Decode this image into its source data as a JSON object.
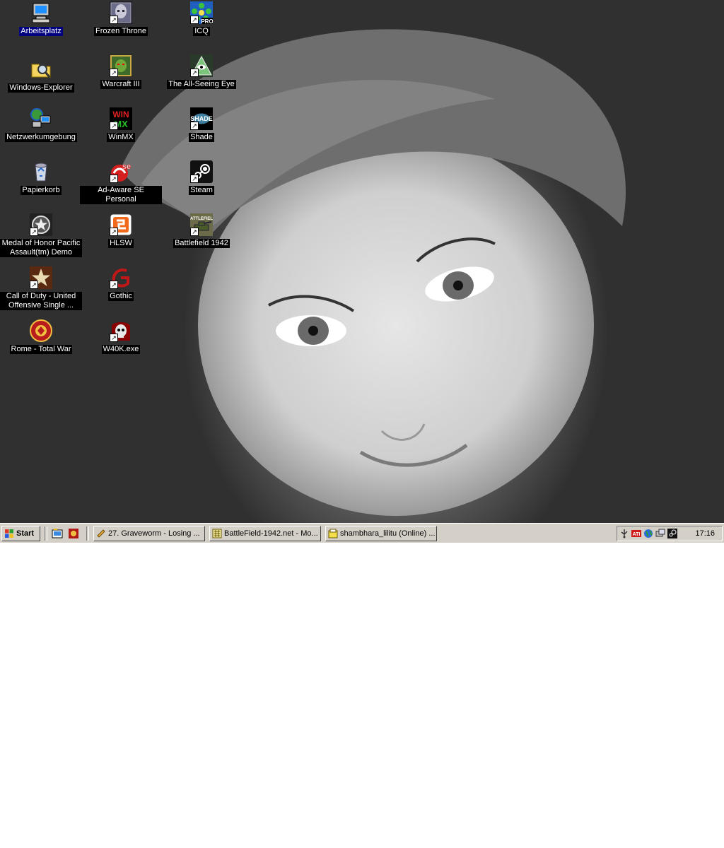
{
  "desktop": {
    "icons": [
      {
        "label": "Arbeitsplatz",
        "icon": "my-computer-icon"
      },
      {
        "label": "Windows-Explorer",
        "icon": "explorer-icon"
      },
      {
        "label": "Netzwerkumgebung",
        "icon": "network-icon"
      },
      {
        "label": "Papierkorb",
        "icon": "recycle-bin-icon"
      },
      {
        "label": "Medal of Honor Pacific Assault(tm) Demo",
        "icon": "medal-of-honor-icon"
      },
      {
        "label": "Call of Duty - United Offensive Single ...",
        "icon": "call-of-duty-icon"
      },
      {
        "label": "Rome - Total War",
        "icon": "rome-total-war-icon"
      },
      {
        "label": "Frozen Throne",
        "icon": "frozen-throne-icon"
      },
      {
        "label": "Warcraft III",
        "icon": "warcraft-icon"
      },
      {
        "label": "WinMX",
        "icon": "winmx-icon"
      },
      {
        "label": "Ad-Aware SE Personal",
        "icon": "ad-aware-icon"
      },
      {
        "label": "HLSW",
        "icon": "hlsw-icon"
      },
      {
        "label": "Gothic",
        "icon": "gothic-icon"
      },
      {
        "label": "W40K.exe",
        "icon": "w40k-icon"
      },
      {
        "label": "ICQ",
        "icon": "icq-icon"
      },
      {
        "label": "The All-Seeing Eye",
        "icon": "all-seeing-eye-icon"
      },
      {
        "label": "Shade",
        "icon": "shade-icon"
      },
      {
        "label": "Steam",
        "icon": "steam-icon"
      },
      {
        "label": "Battlefield 1942",
        "icon": "battlefield-icon"
      }
    ]
  },
  "taskbar": {
    "start_label": "Start",
    "tasks": [
      {
        "label": "27. Graveworm - Losing ...",
        "icon": "winamp-icon"
      },
      {
        "label": "BattleField-1942.net - Mo...",
        "icon": "browser-icon"
      },
      {
        "label": "shambhara_lilitu (Online) ...",
        "icon": "messenger-icon"
      }
    ],
    "clock": "17:16"
  },
  "colors": {
    "taskbar_bg": "#d4d0c8",
    "label_highlight": "#000080"
  }
}
